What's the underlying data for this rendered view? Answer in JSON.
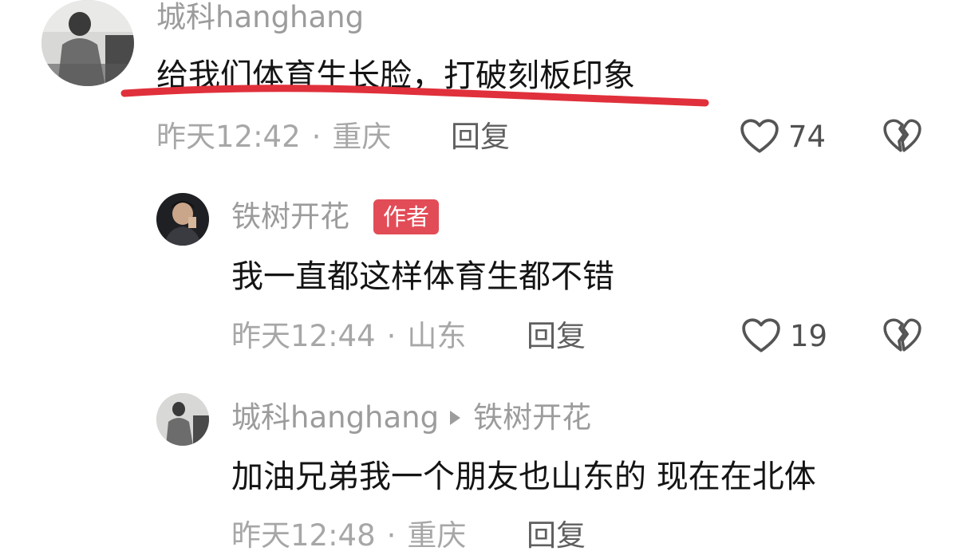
{
  "colors": {
    "author_badge": "#e24c57",
    "highlight_line": "#e0303b",
    "name_gray": "#9c9c9c",
    "meta_gray": "#a7a7a7"
  },
  "comments": [
    {
      "user": "城科hanghang",
      "text": "给我们体育生长脸，打破刻板印象",
      "time": "昨天12:42",
      "sep": "·",
      "location": "重庆",
      "reply_label": "回复",
      "likes": "74",
      "like_icon": "heart-outline-icon",
      "dislike_icon": "broken-heart-icon"
    },
    {
      "user": "铁树开花",
      "badge": "作者",
      "text": "我一直都这样体育生都不错",
      "time": "昨天12:44",
      "sep": "·",
      "location": "山东",
      "reply_label": "回复",
      "likes": "19",
      "like_icon": "heart-outline-icon",
      "dislike_icon": "broken-heart-icon"
    },
    {
      "user": "城科hanghang",
      "reply_to": "铁树开花",
      "text": "加油兄弟我一个朋友也山东的 现在在北体",
      "time": "昨天12:48",
      "sep": "·",
      "location": "重庆",
      "reply_label": "回复"
    }
  ]
}
